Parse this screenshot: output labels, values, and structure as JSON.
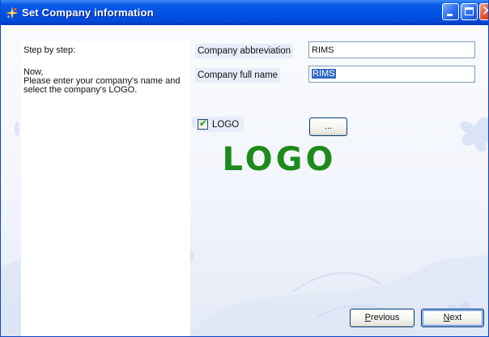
{
  "window": {
    "title": "Set Company information"
  },
  "left_panel": {
    "step_label": "Step by step:",
    "instructions": "Now,\nPlease enter your company's name and\nselect the company's LOGO."
  },
  "form": {
    "abbreviation_label": "Company abbreviation",
    "abbreviation_value": "RIMS",
    "fullname_label": "Company full name",
    "fullname_value": "RIMS",
    "logo_checkbox_label": "LOGO",
    "logo_checked": true,
    "browse_button_label": "..."
  },
  "logo_preview": {
    "text": "LOGO",
    "color": "#1E8A1C"
  },
  "buttons": {
    "previous_prefix": "",
    "previous_hotkey": "P",
    "previous_rest": "revious",
    "next_prefix": "",
    "next_hotkey": "N",
    "next_rest": "ext"
  },
  "icons": {
    "app_icon": "sparkle-star-icon",
    "minimize": "minimize-icon",
    "maximize": "maximize-icon",
    "close": "close-icon",
    "checkbox_tick": "check-icon"
  },
  "colors": {
    "titlebar": "#0052E5",
    "close_button": "#E5522C",
    "selection": "#316AC5",
    "label_background": "#E8EDF8"
  }
}
